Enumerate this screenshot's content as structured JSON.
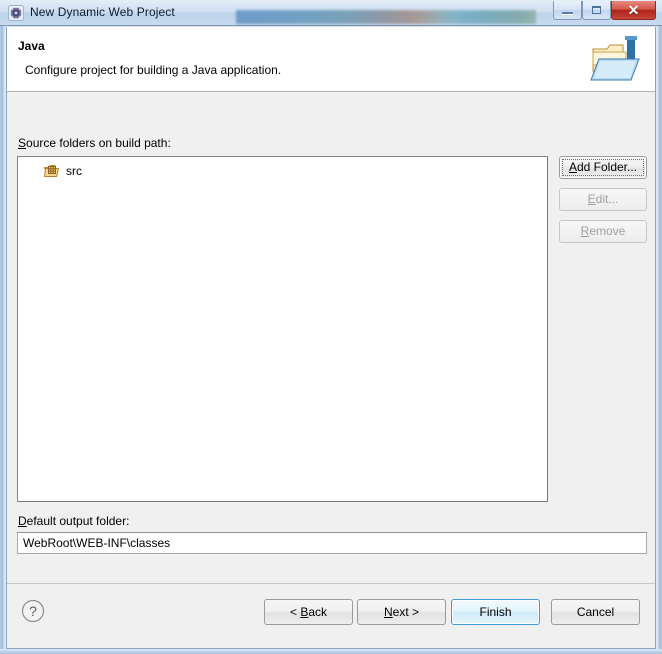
{
  "window": {
    "title": "New Dynamic Web Project",
    "app_icon": "eclipse-icon",
    "controls": {
      "minimize": "minimize-icon",
      "maximize": "restore-icon",
      "close": "✕"
    }
  },
  "header": {
    "title": "Java",
    "description": "Configure project for building a Java application.",
    "icon": "java-folder-banner-icon"
  },
  "source_section": {
    "label_prefix": "",
    "label_mnemonic": "S",
    "label_rest": "ource folders on build path:",
    "label_full": "Source folders on build path:",
    "items": [
      {
        "icon": "package-folder-icon",
        "label": "src"
      }
    ]
  },
  "side_buttons": [
    {
      "mnemonic": "A",
      "rest": "dd Folder...",
      "full": "Add Folder...",
      "enabled": true,
      "focused": true
    },
    {
      "mnemonic": "E",
      "rest": "dit...",
      "full": "Edit...",
      "enabled": false,
      "focused": false
    },
    {
      "mnemonic": "R",
      "rest": "emove",
      "full": "Remove",
      "enabled": false,
      "focused": false
    }
  ],
  "output_section": {
    "label_mnemonic": "D",
    "label_rest": "efault output folder:",
    "label_full": "Default output folder:",
    "value": "WebRoot\\WEB-INF\\classes",
    "placeholder": ""
  },
  "footer": {
    "help_icon": "question-mark-icon",
    "buttons": [
      {
        "prefix": "< ",
        "mnemonic": "B",
        "rest": "ack",
        "full": "< Back",
        "default": false
      },
      {
        "prefix": "",
        "mnemonic": "N",
        "rest": "ext >",
        "full": "Next >",
        "default": false
      },
      {
        "prefix": "",
        "mnemonic": "",
        "rest": "Finish",
        "full": "Finish",
        "default": true
      },
      {
        "prefix": "",
        "mnemonic": "",
        "rest": "Cancel",
        "full": "Cancel",
        "default": false
      }
    ]
  },
  "colors": {
    "dialog_bg": "#f0f0f0",
    "header_bg": "#ffffff",
    "list_bg": "#ffffff",
    "default_button_accent": "#3c9ccd",
    "close_button": "#ad2319",
    "titlebar_top": "#e4eef8"
  }
}
